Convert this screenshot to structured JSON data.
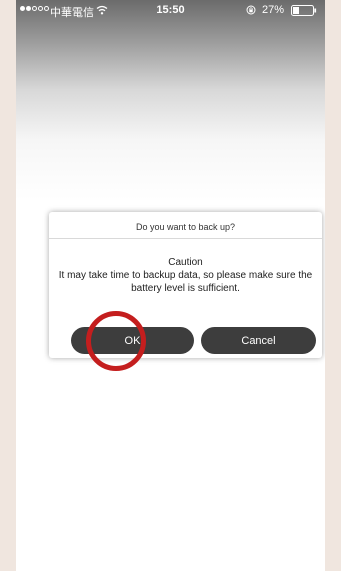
{
  "status_bar": {
    "carrier": "中華電信",
    "time": "15:50",
    "battery": "27%"
  },
  "dialog": {
    "title": "Do you want to back up?",
    "caution": "Caution",
    "message": "It may take time to backup data, so please make sure the battery level is sufficient.",
    "ok_label": "OK",
    "cancel_label": "Cancel"
  },
  "colors": {
    "background": "#f0e6df",
    "button": "#3d3d3d",
    "highlight": "#c41e1e"
  }
}
